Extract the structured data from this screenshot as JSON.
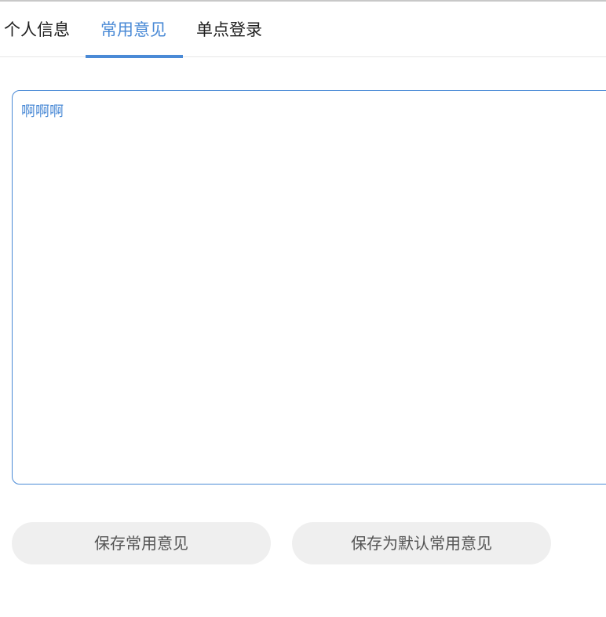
{
  "tabs": [
    {
      "label": "个人信息"
    },
    {
      "label": "常用意见"
    },
    {
      "label": "单点登录"
    }
  ],
  "active_tab": "常用意见",
  "opinion_input": {
    "value": "啊啊啊"
  },
  "buttons": {
    "save_label": "保存常用意见",
    "save_default_label": "保存为默认常用意见"
  },
  "colors": {
    "accent": "#4a8ad6",
    "button_bg": "#efefef",
    "button_text": "#555555"
  }
}
